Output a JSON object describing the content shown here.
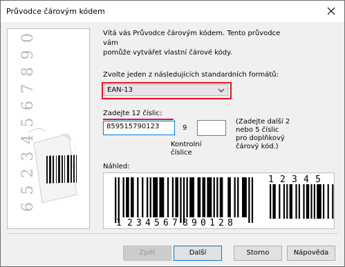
{
  "window": {
    "title": "Průvodce čárovým kódem"
  },
  "intro": {
    "line1": "Vítá vás Průvodce čárovým kódem. Tento průvodce vám",
    "line2": "pomůže vytvářet vlastní čárové kódy."
  },
  "format": {
    "label": "Zvolte jeden z následujících standardních formátů:",
    "selected": "EAN-13"
  },
  "digits": {
    "label": "Zadejte 12 číslic:",
    "value": "859515790123",
    "check_digit": "9",
    "check_label_line1": "Kontrolní",
    "check_label_line2": "číslice",
    "addon_value": "",
    "addon_note": [
      "(Zadejte další 2",
      "nebo 5 číslic",
      "pro doplňkový",
      "čárový kód.)"
    ]
  },
  "preview": {
    "label": "Náhled:",
    "main_digits": [
      "1",
      "2",
      "3",
      "4",
      "5",
      "6",
      "7",
      "8",
      "9",
      "0",
      "1",
      "2",
      "8"
    ],
    "addon_digits": [
      "1",
      "2",
      "3",
      "4",
      "5"
    ]
  },
  "banner": {
    "digits": [
      "0",
      "9",
      "8",
      "7",
      "6",
      "5",
      "4",
      "3",
      "2",
      "5",
      "6"
    ]
  },
  "buttons": {
    "back": "Zpět",
    "next": "Další",
    "cancel": "Storno",
    "help": "Nápověda"
  }
}
